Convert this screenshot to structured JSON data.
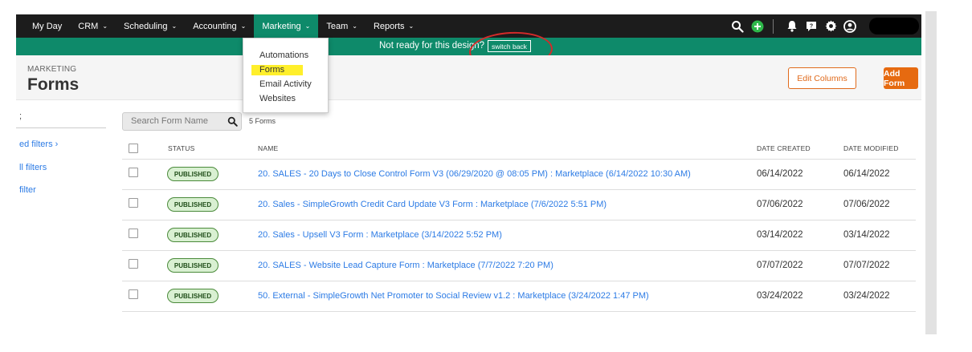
{
  "nav": {
    "items": [
      {
        "label": "My Day",
        "has_menu": false
      },
      {
        "label": "CRM",
        "has_menu": true
      },
      {
        "label": "Scheduling",
        "has_menu": true
      },
      {
        "label": "Accounting",
        "has_menu": true
      },
      {
        "label": "Marketing",
        "has_menu": true,
        "active": true
      },
      {
        "label": "Team",
        "has_menu": true
      },
      {
        "label": "Reports",
        "has_menu": true
      }
    ],
    "icons": [
      "search-icon",
      "add-icon",
      "bell-icon",
      "help-icon",
      "gear-icon",
      "user-icon"
    ]
  },
  "banner": {
    "text": "Not ready for this design?",
    "switch_label": "switch back"
  },
  "marketing_menu": {
    "items": [
      "Automations",
      "Forms",
      "Email Activity",
      "Websites"
    ],
    "highlighted": "Forms"
  },
  "header": {
    "breadcrumb": "MARKETING",
    "title": "Forms",
    "edit_columns_label": "Edit Columns",
    "add_form_label": "Add Form"
  },
  "left_panel": {
    "top_text": ";",
    "links": [
      "ed filters ›",
      "ll filters",
      "filter"
    ]
  },
  "search": {
    "placeholder": "Search Form Name",
    "count_text": "5 Forms"
  },
  "table": {
    "headers": {
      "status": "STATUS",
      "name": "NAME",
      "date_created": "DATE CREATED",
      "date_modified": "DATE MODIFIED"
    },
    "rows": [
      {
        "status": "PUBLISHED",
        "name": "20. SALES - 20 Days to Close Control Form V3 (06/29/2020 @ 08:05 PM) : Marketplace (6/14/2022 10:30 AM)",
        "date_created": "06/14/2022",
        "date_modified": "06/14/2022"
      },
      {
        "status": "PUBLISHED",
        "name": "20. Sales - SimpleGrowth Credit Card Update V3 Form : Marketplace (7/6/2022 5:51 PM)",
        "date_created": "07/06/2022",
        "date_modified": "07/06/2022"
      },
      {
        "status": "PUBLISHED",
        "name": "20. Sales - Upsell V3 Form : Marketplace (3/14/2022 5:52 PM)",
        "date_created": "03/14/2022",
        "date_modified": "03/14/2022"
      },
      {
        "status": "PUBLISHED",
        "name": "20. SALES - Website Lead Capture Form : Marketplace (7/7/2022 7:20 PM)",
        "date_created": "07/07/2022",
        "date_modified": "07/07/2022"
      },
      {
        "status": "PUBLISHED",
        "name": "50. External - SimpleGrowth Net Promoter to Social Review v1.2 : Marketplace (3/24/2022 1:47 PM)",
        "date_created": "03/24/2022",
        "date_modified": "03/24/2022"
      }
    ]
  },
  "colors": {
    "nav_bg": "#1c1c1c",
    "accent_green": "#0e8a6a",
    "orange": "#e66a10",
    "link_blue": "#2c7be5",
    "highlight_yellow": "#ffef2b",
    "annotation_red": "#d42a2a"
  }
}
